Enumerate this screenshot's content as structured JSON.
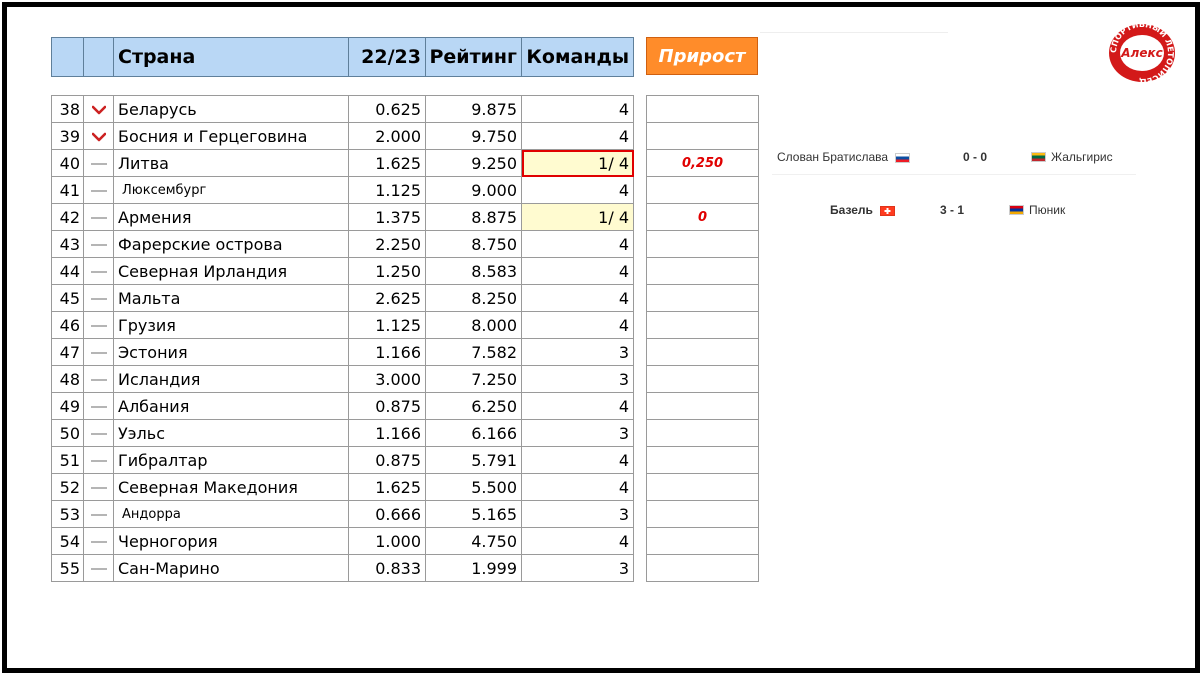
{
  "header": {
    "country": "Страна",
    "season": "22/23",
    "rating": "Рейтинг",
    "teams": "Команды",
    "growth": "Прирост"
  },
  "rows": [
    {
      "rank": "38",
      "trend": "down",
      "country": "Беларусь",
      "season": "0.625",
      "rating": "9.875",
      "teams": "4",
      "growth": ""
    },
    {
      "rank": "39",
      "trend": "down",
      "country": "Босния и Герцеговина",
      "season": "2.000",
      "rating": "9.750",
      "teams": "4",
      "growth": ""
    },
    {
      "rank": "40",
      "trend": "same",
      "country": "Литва",
      "season": "1.625",
      "rating": "9.250",
      "teams": "1/ 4",
      "growth": "0,250",
      "highlight": true,
      "redBorder": true
    },
    {
      "rank": "41",
      "trend": "same",
      "country": "Люксембург",
      "season": "1.125",
      "rating": "9.000",
      "teams": "4",
      "growth": "",
      "small": true
    },
    {
      "rank": "42",
      "trend": "same",
      "country": "Армения",
      "season": "1.375",
      "rating": "8.875",
      "teams": "1/ 4",
      "growth": "0",
      "highlight": true
    },
    {
      "rank": "43",
      "trend": "same",
      "country": "Фарерские острова",
      "season": "2.250",
      "rating": "8.750",
      "teams": "4",
      "growth": ""
    },
    {
      "rank": "44",
      "trend": "same",
      "country": "Северная Ирландия",
      "season": "1.250",
      "rating": "8.583",
      "teams": "4",
      "growth": ""
    },
    {
      "rank": "45",
      "trend": "same",
      "country": "Мальта",
      "season": "2.625",
      "rating": "8.250",
      "teams": "4",
      "growth": ""
    },
    {
      "rank": "46",
      "trend": "same",
      "country": "Грузия",
      "season": "1.125",
      "rating": "8.000",
      "teams": "4",
      "growth": ""
    },
    {
      "rank": "47",
      "trend": "same",
      "country": "Эстония",
      "season": "1.166",
      "rating": "7.582",
      "teams": "3",
      "growth": ""
    },
    {
      "rank": "48",
      "trend": "same",
      "country": "Исландия",
      "season": "3.000",
      "rating": "7.250",
      "teams": "3",
      "growth": ""
    },
    {
      "rank": "49",
      "trend": "same",
      "country": "Албания",
      "season": "0.875",
      "rating": "6.250",
      "teams": "4",
      "growth": ""
    },
    {
      "rank": "50",
      "trend": "same",
      "country": "Уэльс",
      "season": "1.166",
      "rating": "6.166",
      "teams": "3",
      "growth": ""
    },
    {
      "rank": "51",
      "trend": "same",
      "country": "Гибралтар",
      "season": "0.875",
      "rating": "5.791",
      "teams": "4",
      "growth": ""
    },
    {
      "rank": "52",
      "trend": "same",
      "country": "Северная Македония",
      "season": "1.625",
      "rating": "5.500",
      "teams": "4",
      "growth": ""
    },
    {
      "rank": "53",
      "trend": "same",
      "country": "Андорра",
      "season": "0.666",
      "rating": "5.165",
      "teams": "3",
      "growth": "",
      "small": true
    },
    {
      "rank": "54",
      "trend": "same",
      "country": "Черногория",
      "season": "1.000",
      "rating": "4.750",
      "teams": "4",
      "growth": ""
    },
    {
      "rank": "55",
      "trend": "same",
      "country": "Сан-Марино",
      "season": "0.833",
      "rating": "1.999",
      "teams": "3",
      "growth": ""
    }
  ],
  "matches": [
    {
      "home": "Слован Братислава",
      "home_flag": "slovakia-flag",
      "score": "0 - 0",
      "away": "Жальгирис",
      "away_flag": "lithuania-flag"
    },
    {
      "home": "Базель",
      "home_flag": "switzerland-flag",
      "score": "3 - 1",
      "away": "Пюник",
      "away_flag": "armenia-flag"
    }
  ],
  "logo": {
    "text": "Алекс",
    "ring_text": "СПОРТИВНЫЙ ЛЕТОПИСЕЦ"
  },
  "colors": {
    "header_bg": "#b9d7f5",
    "growth_bg": "#ff8c2a",
    "highlight_bg": "#fffbd0",
    "accent_red": "#e00000",
    "trend_down": "#cc2222"
  }
}
